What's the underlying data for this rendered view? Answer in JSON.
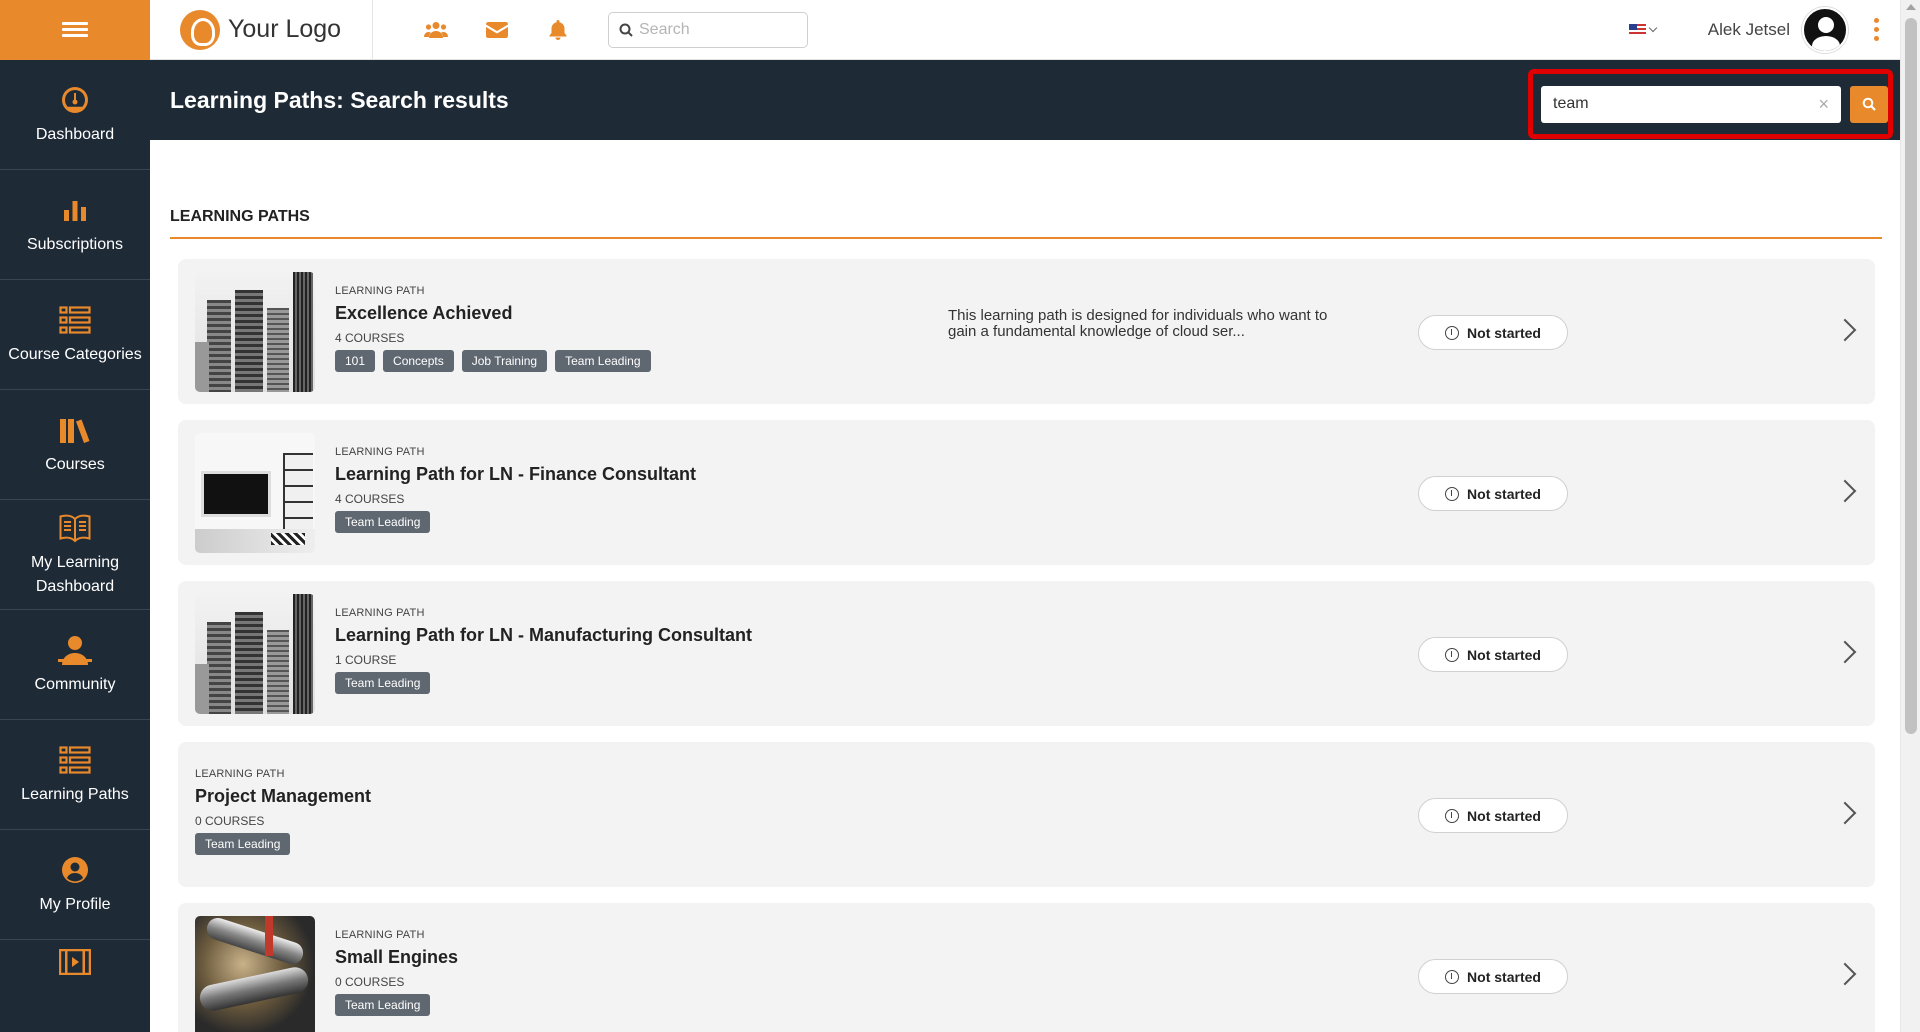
{
  "app": {
    "logo_text": "Your Logo",
    "search_placeholder": "Search",
    "user_name": "Alek Jetsel",
    "accent_color": "#e8892c",
    "nav_dark_color": "#1e2a36"
  },
  "topbar": {
    "icons": [
      "users-icon",
      "mail-icon",
      "bell-icon"
    ],
    "language_flag": "us-flag-icon"
  },
  "sidebar": {
    "items": [
      {
        "label": "Dashboard",
        "icon": "speedometer-icon"
      },
      {
        "label": "Subscriptions",
        "icon": "bar-chart-icon"
      },
      {
        "label": "Course Categories",
        "icon": "list-icon"
      },
      {
        "label": "Courses",
        "icon": "books-icon"
      },
      {
        "label": "My Learning Dashboard",
        "icon": "open-book-icon"
      },
      {
        "label": "Community",
        "icon": "community-icon"
      },
      {
        "label": "Learning Paths",
        "icon": "list-icon"
      },
      {
        "label": "My Profile",
        "icon": "user-circle-icon"
      }
    ]
  },
  "header": {
    "title": "Learning Paths: Search results",
    "search_value": "team",
    "clear_symbol": "×"
  },
  "main": {
    "section_title": "LEARNING PATHS",
    "items": [
      {
        "kind": "LEARNING PATH",
        "title": "Excellence Achieved",
        "count": "4 COURSES",
        "tags": [
          "101",
          "Concepts",
          "Job Training",
          "Team Leading"
        ],
        "description": "This learning path is designed for individuals who want to gain a fundamental knowledge of cloud ser...",
        "status": "Not started",
        "thumbnail": "city"
      },
      {
        "kind": "LEARNING PATH",
        "title": "Learning Path for LN - Finance Consultant",
        "count": "4 COURSES",
        "tags": [
          "Team Leading"
        ],
        "description": "",
        "status": "Not started",
        "thumbnail": "office"
      },
      {
        "kind": "LEARNING PATH",
        "title": "Learning Path for LN - Manufacturing Consultant",
        "count": "1 COURSE",
        "tags": [
          "Team Leading"
        ],
        "description": "",
        "status": "Not started",
        "thumbnail": "city"
      },
      {
        "kind": "LEARNING PATH",
        "title": "Project Management",
        "count": "0 COURSES",
        "tags": [
          "Team Leading"
        ],
        "description": "",
        "status": "Not started",
        "thumbnail": ""
      },
      {
        "kind": "LEARNING PATH",
        "title": "Small Engines",
        "count": "0 COURSES",
        "tags": [
          "Team Leading"
        ],
        "description": "",
        "status": "Not started",
        "thumbnail": "engine"
      }
    ]
  }
}
